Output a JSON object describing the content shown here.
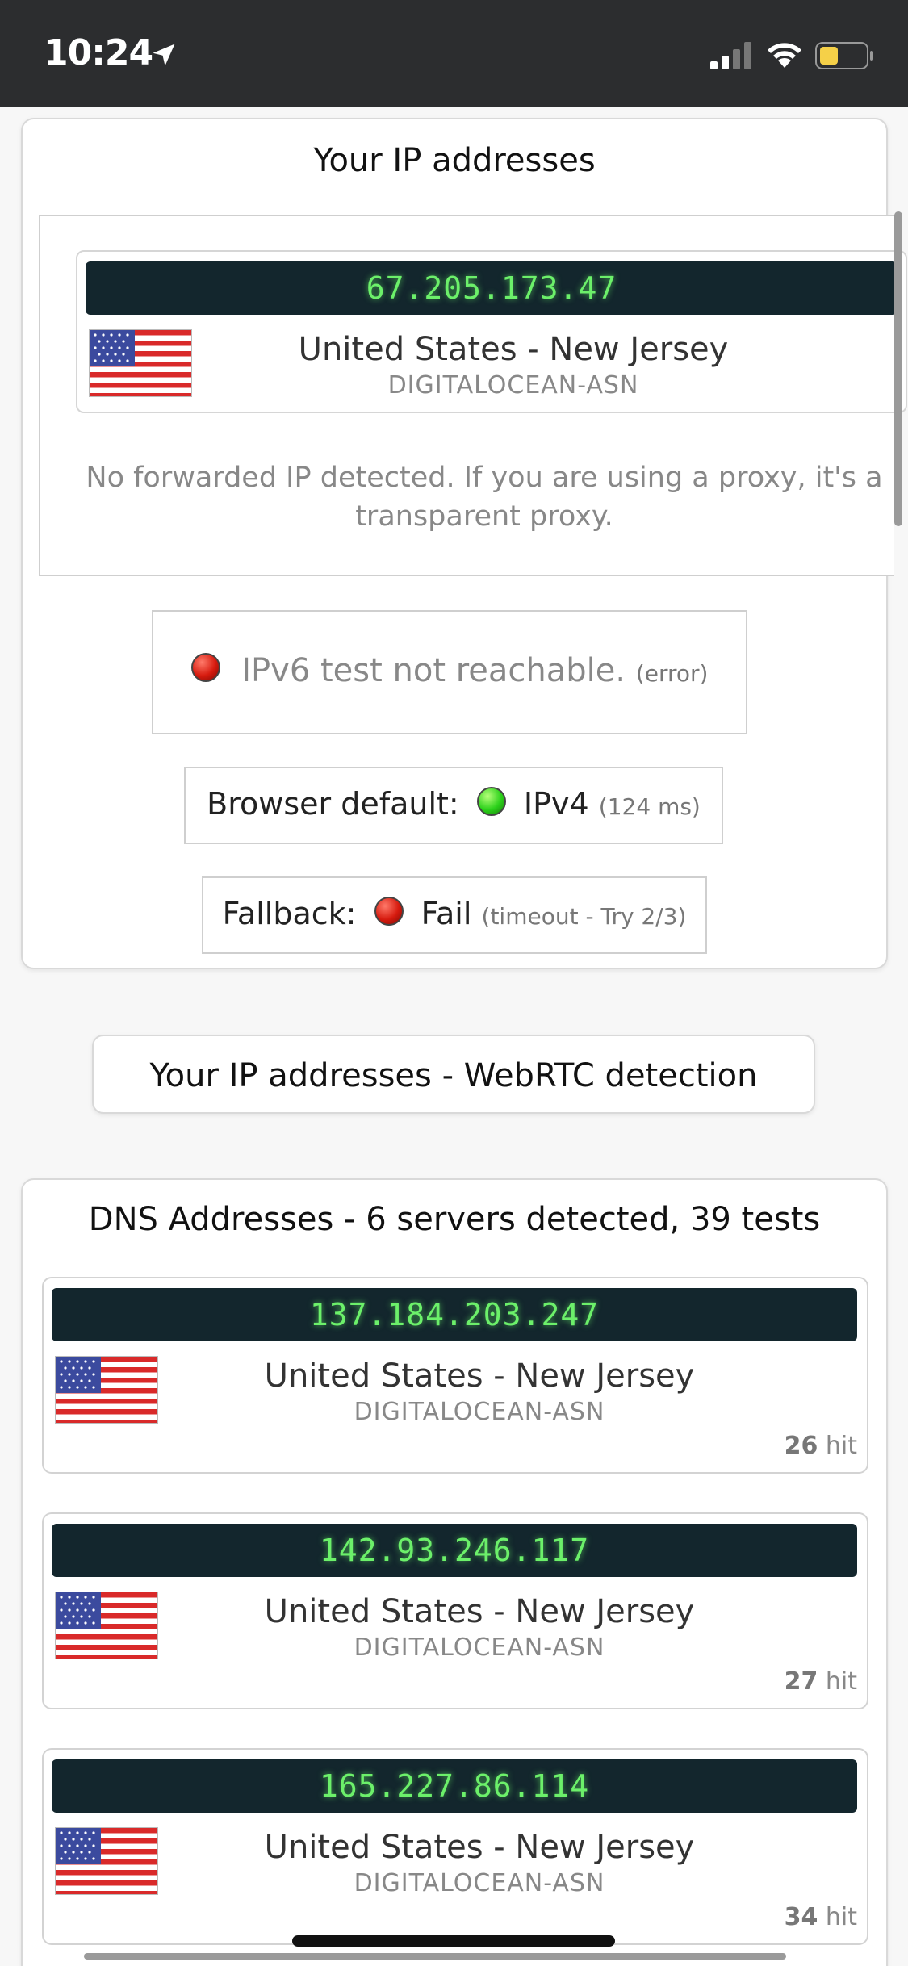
{
  "status_bar": {
    "time": "10:24",
    "icons": [
      "location-arrow-icon",
      "cellular-signal-icon",
      "wifi-icon",
      "battery-icon"
    ]
  },
  "ip_section": {
    "title": "Your IP addresses",
    "ip": "67.205.173.47",
    "location": "United States - New Jersey",
    "asn": "DIGITALOCEAN-ASN",
    "note": "No forwarded IP detected. If you are using a proxy, it's a transparent proxy."
  },
  "ipv6": {
    "status": "IPv6 test not reachable.",
    "detail": "(error)"
  },
  "browser_default": {
    "label": "Browser default:",
    "protocol": "IPv4",
    "detail": "(124 ms)"
  },
  "fallback": {
    "label": "Fallback:",
    "result": "Fail",
    "detail": "(timeout - Try 2/3)"
  },
  "webrtc": {
    "button_label": "Your IP addresses - WebRTC detection"
  },
  "dns_section": {
    "title": "DNS Addresses - 6 servers detected, 39 tests",
    "servers": [
      {
        "ip": "137.184.203.247",
        "location": "United States - New Jersey",
        "asn": "DIGITALOCEAN-ASN",
        "hits": "26",
        "hit_label": "hit"
      },
      {
        "ip": "142.93.246.117",
        "location": "United States - New Jersey",
        "asn": "DIGITALOCEAN-ASN",
        "hits": "27",
        "hit_label": "hit"
      },
      {
        "ip": "165.227.86.114",
        "location": "United States - New Jersey",
        "asn": "DIGITALOCEAN-ASN",
        "hits": "34",
        "hit_label": "hit"
      }
    ]
  },
  "colors": {
    "banner_bg": "#13262d",
    "banner_text": "#6cf06a",
    "status_bar": "#2c2d2f",
    "red_dot": "#d61a0e",
    "green_dot": "#2bd11a"
  }
}
